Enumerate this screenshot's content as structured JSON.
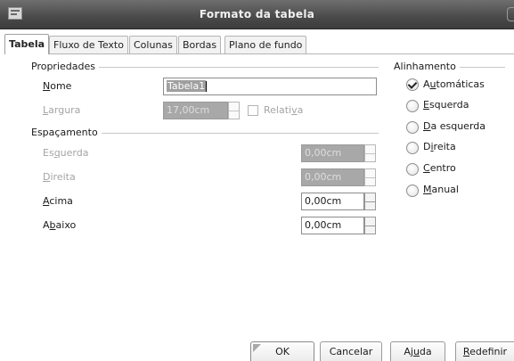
{
  "window": {
    "title": "Formato da tabela"
  },
  "tabs": [
    {
      "label": "Tabela",
      "active": true
    },
    {
      "label": "Fluxo de Texto"
    },
    {
      "label": "Colunas"
    },
    {
      "label": "Bordas"
    },
    {
      "label": "Plano de fundo"
    }
  ],
  "propriedades": {
    "group_label": "Propriedades",
    "nome_label": "Nome",
    "nome_value": "Tabela1",
    "largura_label": "Largura",
    "largura_value": "17,00cm",
    "relativa_label": "Relativa"
  },
  "espacamento": {
    "group_label": "Espaçamento",
    "esquerda_label": "Esquerda",
    "esquerda_value": "0,00cm",
    "direita_label": "Direita",
    "direita_value": "0,00cm",
    "acima_label": "Acima",
    "acima_value": "0,00cm",
    "abaixo_label": "Abaixo",
    "abaixo_value": "0,00cm"
  },
  "alinhamento": {
    "group_label": "Alinhamento",
    "options": [
      "Automáticas",
      "Esquerda",
      "Da esquerda",
      "Direita",
      "Centro",
      "Manual"
    ],
    "selected": "Automáticas"
  },
  "buttons": {
    "ok": "OK",
    "cancelar": "Cancelar",
    "ajuda": "Ajuda",
    "redefinir": "Redefinir"
  }
}
